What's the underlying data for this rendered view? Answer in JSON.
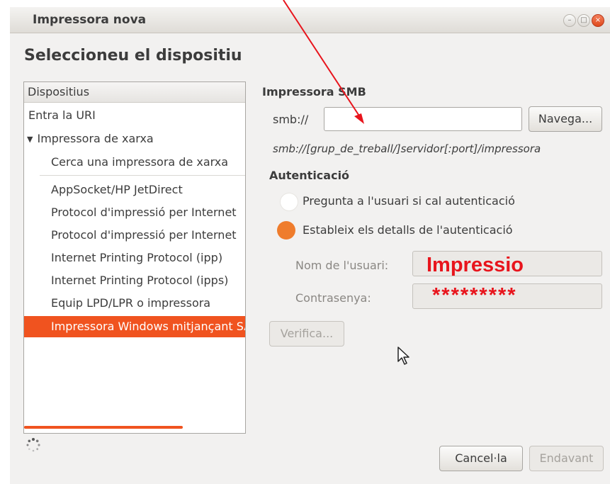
{
  "window": {
    "title": "Impressora nova",
    "heading": "Seleccioneu el dispositiu"
  },
  "device_list": {
    "header": "Dispositius",
    "items": [
      {
        "label": "Entra la URI"
      },
      {
        "label": "Impressora de xarxa",
        "expanded": true
      },
      {
        "label": "Cerca una impressora de xarxa"
      },
      {
        "label": "AppSocket/HP JetDirect"
      },
      {
        "label": "Protocol d'impressió per Internet"
      },
      {
        "label": "Protocol d'impressió per Internet"
      },
      {
        "label": "Internet Printing Protocol (ipp)"
      },
      {
        "label": "Internet Printing Protocol (ipps)"
      },
      {
        "label": "Equip LPD/LPR o impressora"
      },
      {
        "label": "Impressora Windows mitjançant SAMBA",
        "selected": true
      }
    ]
  },
  "smb": {
    "section_title": "Impressora SMB",
    "uri_prefix": "smb://",
    "uri_value": "",
    "browse_label": "Navega...",
    "uri_hint": "smb://[grup_de_treball/]servidor[:port]/impressora"
  },
  "auth": {
    "section_title": "Autenticació",
    "option_ask": "Pregunta a l'usuari si cal autenticació",
    "option_set": "Estableix els detalls de l'autenticació",
    "selected_option": "option_set",
    "username_label": "Nom de l'usuari:",
    "username_value": "Impressio",
    "password_label": "Contrasenya:",
    "password_value": "*********",
    "verify_label": "Verifica..."
  },
  "footer": {
    "cancel_label": "Cancel·la",
    "forward_label": "Endavant"
  },
  "colors": {
    "accent": "#f0531f",
    "radio_selected": "#ef7c2c",
    "annotation": "#e8141c"
  }
}
